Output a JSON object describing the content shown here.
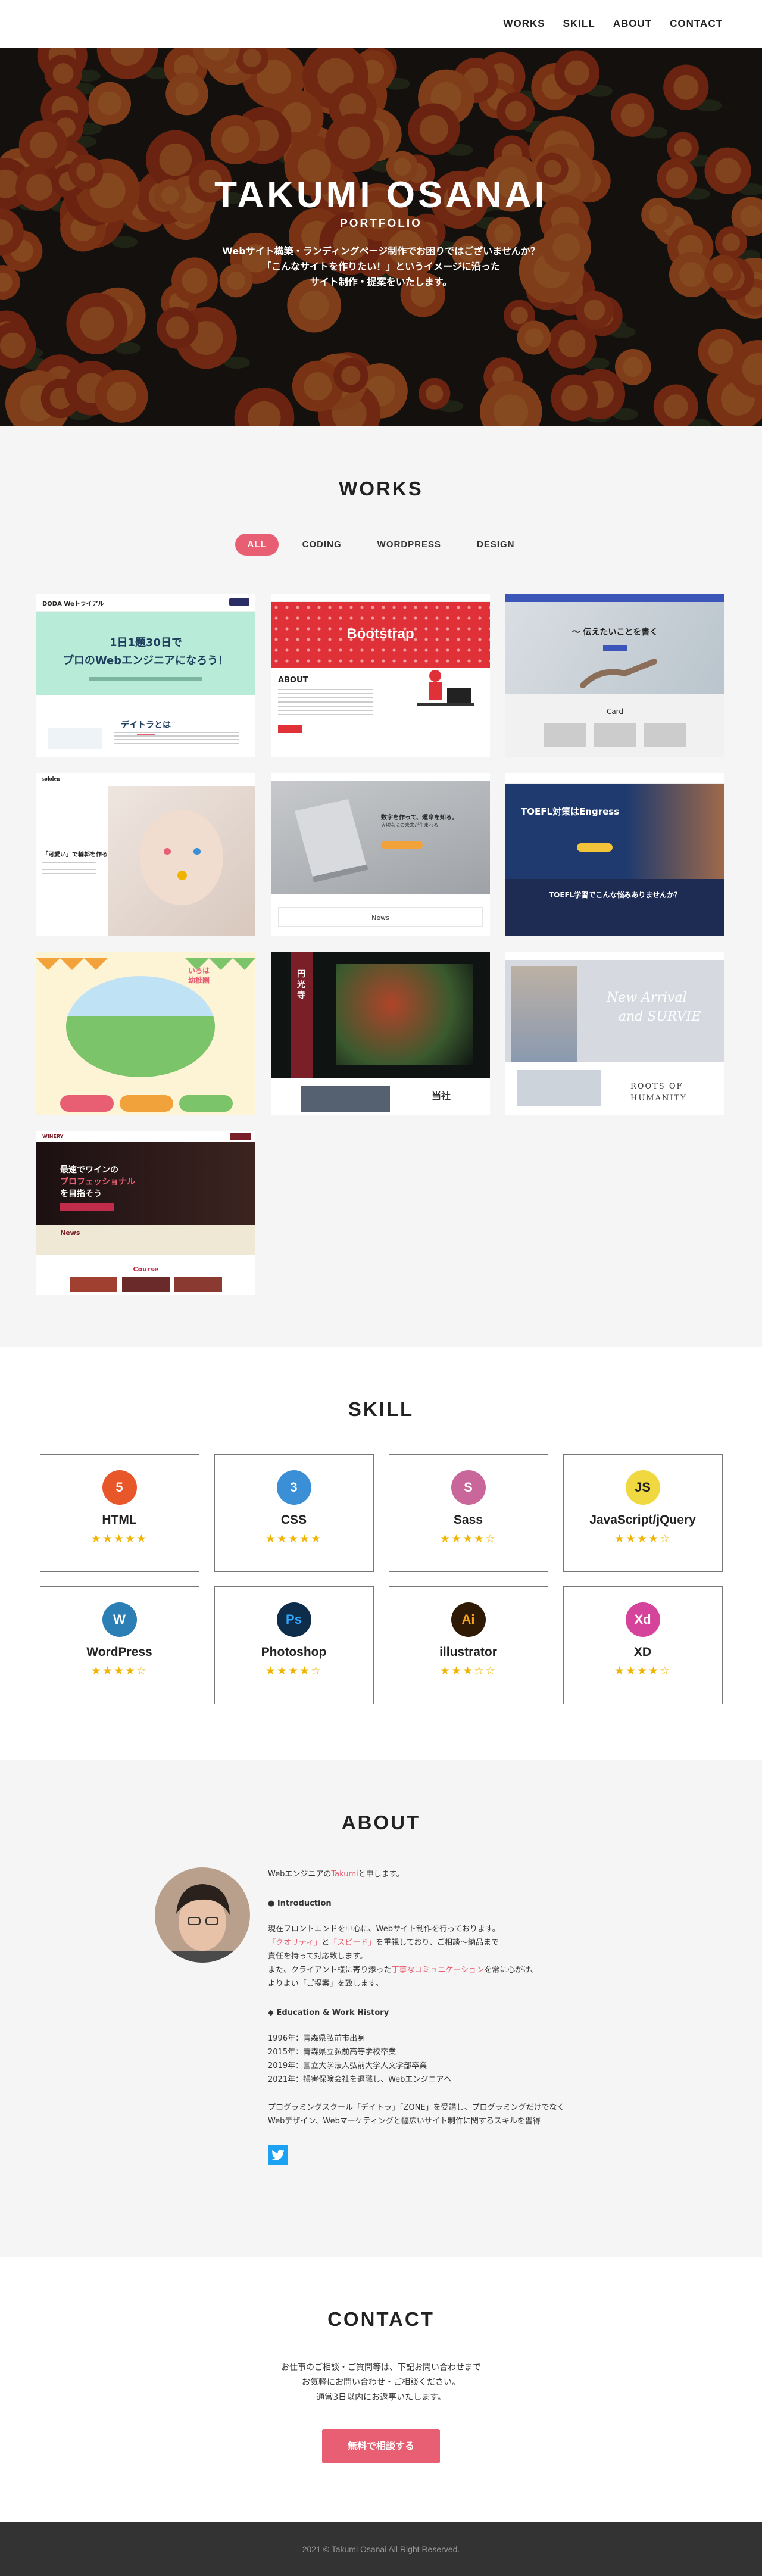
{
  "nav": {
    "items": [
      "WORKS",
      "SKILL",
      "ABOUT",
      "CONTACT"
    ]
  },
  "hero": {
    "title": "TAKUMI OSANAI",
    "subtitle": "PORTFOLIO",
    "desc": [
      "Webサイト構築・ランディングページ制作でお困りではございませんか？",
      "「こんなサイトを作りたい！」というイメージに沿った",
      "サイト制作・提案をいたします。"
    ]
  },
  "works": {
    "title": "WORKS",
    "filters": [
      "ALL",
      "CODING",
      "WORDPRESS",
      "DESIGN"
    ],
    "cards": {
      "c1": {
        "logo": "DODA Weトライアル",
        "headline1": "1日1題30日で",
        "headline2": "プロのWebエンジニアになろう！",
        "section": "デイトラとは"
      },
      "c2": {
        "brand": "Bootstrap",
        "section": "ABOUT"
      },
      "c3": {
        "headline": "〜 伝えたいことを書く",
        "section": "Card"
      },
      "c4": {
        "logo": "sololeu",
        "copy": "「可愛い」で輪郭を作る"
      },
      "c5": {
        "copy1": "数字を作って、運命を知る。",
        "copy2": "大切なにの未来が生まれる",
        "section": "News"
      },
      "c6": {
        "brand": "TOEFL対策はEngress",
        "copy": "TOEFL学習でこんな悩みありませんか？"
      },
      "c7": {
        "title1": "いろは",
        "title2": "幼稚園"
      },
      "c8": {
        "vertical": "円光寺",
        "chars": "当社"
      },
      "c9": {
        "script1": "New Arrival",
        "script2": "and SURVIE",
        "section1": "ROOTS OF",
        "section2": "HUMANITY"
      },
      "c10": {
        "logo": "WINERY",
        "copy1": "最速でワインの",
        "copy2": "プロフェッショナル",
        "copy3": "を目指そう",
        "section1": "News",
        "section2": "Course"
      }
    }
  },
  "skill": {
    "title": "SKILL",
    "items": [
      {
        "name": "HTML",
        "stars": "★★★★★",
        "rating": 5,
        "icon": "html5-icon",
        "glyph": "5",
        "color": "#e8572a"
      },
      {
        "name": "CSS",
        "stars": "★★★★★",
        "rating": 5,
        "icon": "css3-icon",
        "glyph": "3",
        "color": "#3a8fd6"
      },
      {
        "name": "Sass",
        "stars": "★★★★☆",
        "rating": 4,
        "icon": "sass-icon",
        "glyph": "S",
        "color": "#c9669a"
      },
      {
        "name": "JavaScript/jQuery",
        "stars": "★★★★☆",
        "rating": 4,
        "icon": "js-icon",
        "glyph": "JS",
        "color": "#f0d840"
      },
      {
        "name": "WordPress",
        "stars": "★★★★☆",
        "rating": 4,
        "icon": "wordpress-icon",
        "glyph": "W",
        "color": "#2b7fb5"
      },
      {
        "name": "Photoshop",
        "stars": "★★★★☆",
        "rating": 4,
        "icon": "photoshop-icon",
        "glyph": "Ps",
        "color": "#0d2d4a"
      },
      {
        "name": "illustrator",
        "stars": "★★★☆☆",
        "rating": 3,
        "icon": "illustrator-icon",
        "glyph": "Ai",
        "color": "#2e1a05"
      },
      {
        "name": "XD",
        "stars": "★★★★☆",
        "rating": 4,
        "icon": "xd-icon",
        "glyph": "Xd",
        "color": "#d6439a"
      }
    ]
  },
  "about": {
    "title": "ABOUT",
    "intro_pre": "Webエンジニアの",
    "intro_name": "Takumi",
    "intro_post": "と申します。",
    "intro_heading": "Introduction",
    "intro1": "現在フロントエンドを中心に、Webサイト制作を行っております。",
    "intro2a": "「クオリティ」",
    "intro2b": "と",
    "intro2c": "「スピード」",
    "intro2d": "を重視しており、ご相談〜納品まで",
    "intro3": "責任を持って対応致します。",
    "intro4a": "また、クライアント様に寄り添った",
    "intro4b": "丁寧なコミュニケーション",
    "intro4c": "を常に心がけ、",
    "intro5": "よりよい「ご提案」を致します。",
    "history_heading": "Education & Work History",
    "history": [
      "1996年：青森県弘前市出身",
      "2015年：青森県立弘前高等学校卒業",
      "2019年：国立大学法人弘前大学人文学部卒業",
      "2021年：損害保険会社を退職し、Webエンジニアへ"
    ],
    "closing1": "プログラミングスクール「デイトラ」「ZONE」を受講し、プログラミングだけでなく",
    "closing2": "Webデザイン、Webマーケティングと幅広いサイト制作に関するスキルを習得"
  },
  "contact": {
    "title": "CONTACT",
    "lines": [
      "お仕事のご相談・ご質問等は、下記お問い合わせまで",
      "お気軽にお問い合わせ・ご相談ください。",
      "通常3日以内にお返事いたします。"
    ],
    "button": "無料で相談する"
  },
  "footer": {
    "copyright": "2021 © Takumi Osanai All Right Reserved."
  },
  "colors": {
    "accent": "#e85f73",
    "star": "#f0b400",
    "footer_bg": "#333333",
    "section_bg": "#f5f5f5"
  }
}
